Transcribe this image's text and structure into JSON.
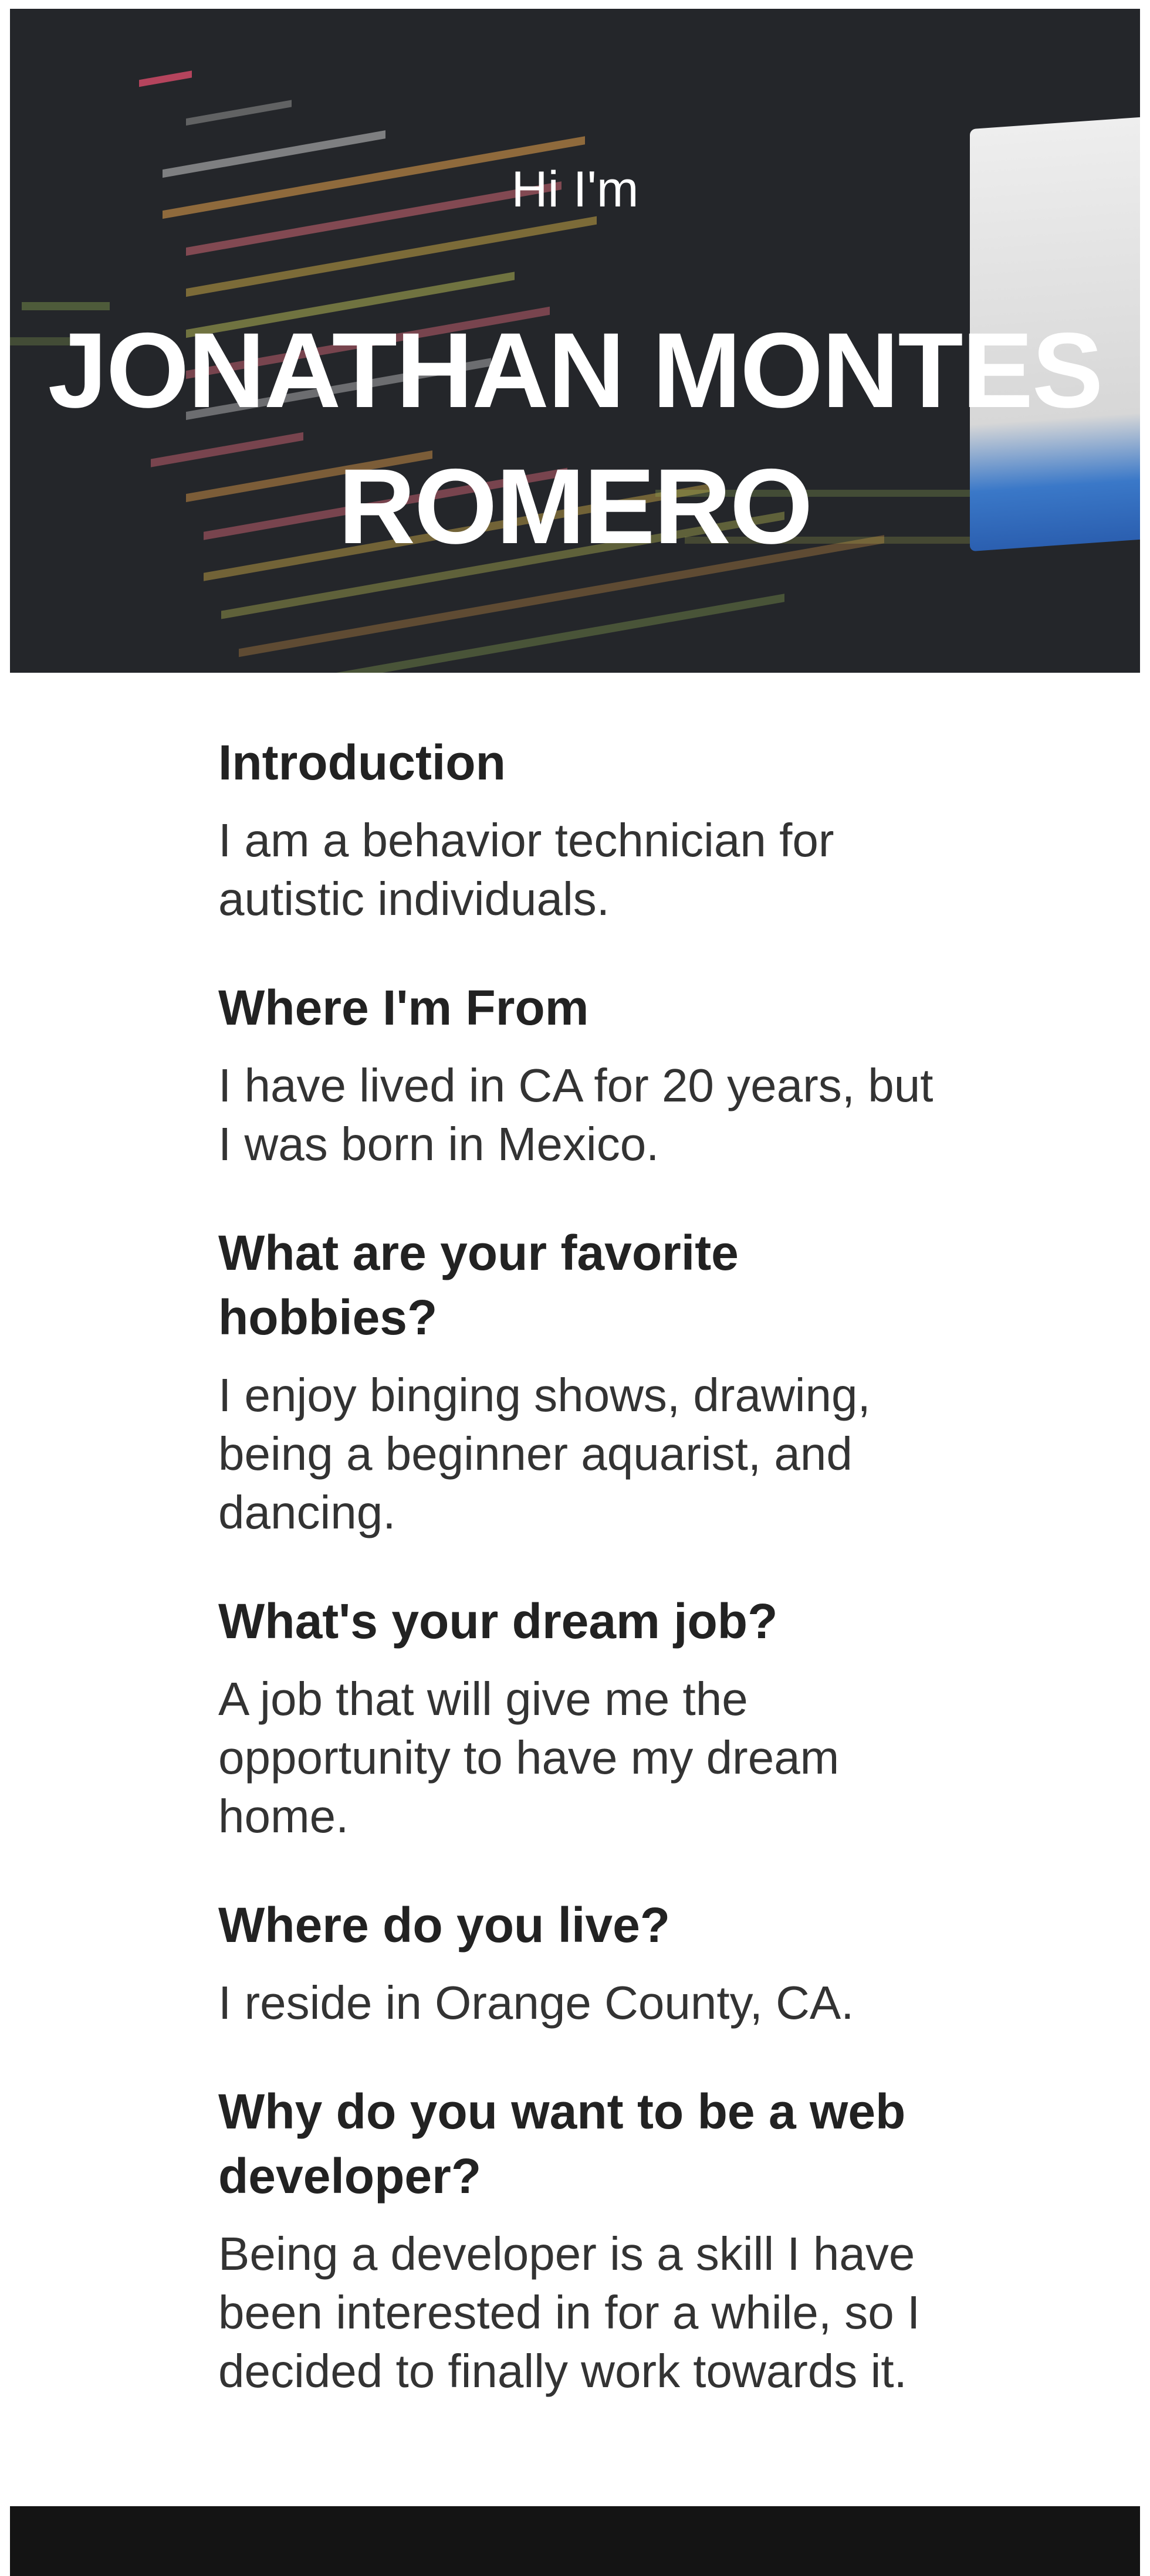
{
  "hero": {
    "greeting": "Hi I'm",
    "name": "JONATHAN MONTES ROMERO"
  },
  "sections": [
    {
      "heading": "Introduction",
      "body": "I am a behavior technician for autistic individuals."
    },
    {
      "heading": "Where I'm From",
      "body": "I have lived in CA for 20 years, but I was born in Mexico."
    },
    {
      "heading": "What are your favorite hobbies?",
      "body": "I enjoy binging shows, drawing, being a beginner aquarist, and dancing."
    },
    {
      "heading": "What's your dream job?",
      "body": "A job that will give me the opportunity to have my dream home."
    },
    {
      "heading": "Where do you live?",
      "body": "I reside in Orange County, CA."
    },
    {
      "heading": "Why do you want to be a web developer?",
      "body": "Being a developer is a skill I have been interested in for a while, so I decided to finally work towards it."
    }
  ]
}
